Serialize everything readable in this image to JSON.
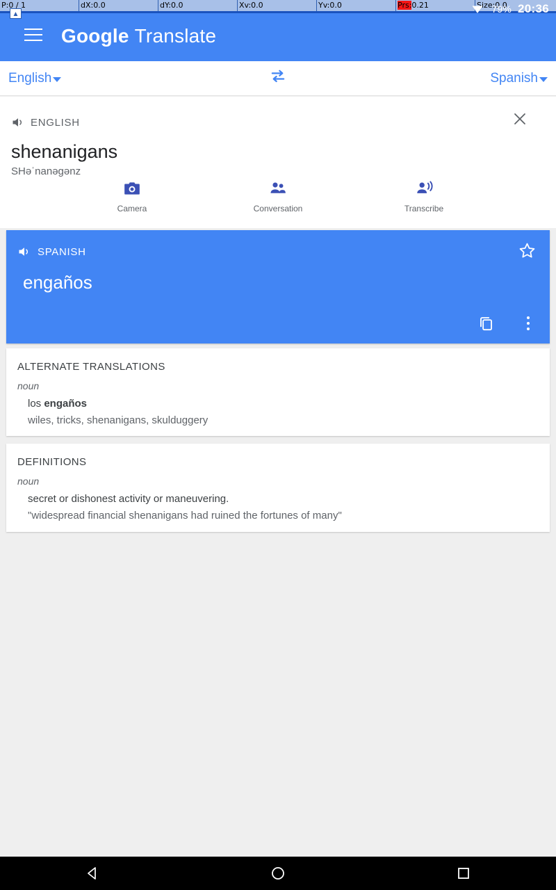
{
  "debug_overlay": {
    "cells": [
      {
        "label": "P:",
        "value": "0 / 1",
        "highlight": false
      },
      {
        "label": "dX:",
        "value": "0.0",
        "highlight": false
      },
      {
        "label": "dY:",
        "value": "0.0",
        "highlight": false
      },
      {
        "label": "Xv:",
        "value": "0.0",
        "highlight": false
      },
      {
        "label": "Yv:",
        "value": "0.0",
        "highlight": false
      },
      {
        "label": "Prs:",
        "value": "0.21",
        "highlight": true
      },
      {
        "label": "Size:",
        "value": "0.0",
        "highlight": false
      }
    ]
  },
  "status_bar": {
    "battery": "79%",
    "clock": "20:36",
    "wifi_icon": "wifi-icon"
  },
  "appbar": {
    "menu_icon": "hamburger-menu-icon",
    "brand_bold": "Google",
    "brand_light": "Translate",
    "background": "#4285f4"
  },
  "language_bar": {
    "source": "English",
    "target": "Spanish",
    "swap_icon": "swap-languages-icon",
    "accent": "#4285f4"
  },
  "source_panel": {
    "speaker_icon": "speaker-icon",
    "language_label": "ENGLISH",
    "close_icon": "close-icon",
    "text": "shenanigans",
    "phonetic": "SHəˈnanəgənz"
  },
  "actions": [
    {
      "icon": "camera-icon",
      "label": "Camera"
    },
    {
      "icon": "conversation-icon",
      "label": "Conversation"
    },
    {
      "icon": "transcribe-icon",
      "label": "Transcribe"
    }
  ],
  "translation_card": {
    "speaker_icon": "speaker-icon",
    "language_label": "SPANISH",
    "text": "engaños",
    "star_icon": "star-outline-icon",
    "copy_icon": "copy-icon",
    "overflow_icon": "more-vert-icon",
    "background": "#4285f4"
  },
  "alternates": {
    "title": "ALTERNATE TRANSLATIONS",
    "pos": "noun",
    "article": "los ",
    "word": "engaños",
    "synonyms": "wiles, tricks, shenanigans, skulduggery"
  },
  "definitions": {
    "title": "DEFINITIONS",
    "pos": "noun",
    "definition": "secret or dishonest activity or maneuvering.",
    "example": "\"widespread financial shenanigans had ruined the fortunes of many\""
  },
  "navbar": {
    "back_icon": "back-triangle-icon",
    "home_icon": "home-circle-icon",
    "recents_icon": "recents-square-icon"
  }
}
